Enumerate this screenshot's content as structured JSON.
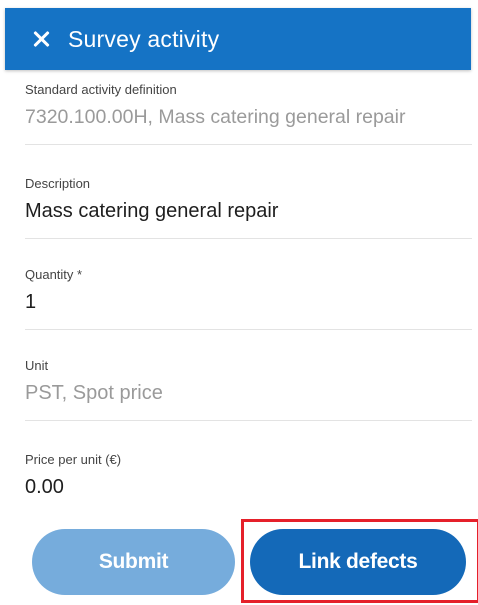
{
  "header": {
    "title": "Survey activity",
    "close_icon": "close-icon",
    "background_color": "#1573c5"
  },
  "fields": {
    "standard_activity": {
      "label": "Standard activity definition",
      "value": "7320.100.00H, Mass catering general repair"
    },
    "description": {
      "label": "Description",
      "value": "Mass catering general repair"
    },
    "quantity": {
      "label": "Quantity *",
      "value": "1"
    },
    "unit": {
      "label": "Unit",
      "value": "PST, Spot price"
    },
    "price_per_unit": {
      "label": "Price per unit (€)",
      "value": "0.00"
    }
  },
  "actions": {
    "submit_label": "Submit",
    "link_defects_label": "Link defects",
    "submit_color": "#76acdc",
    "link_defects_color": "#1469b8",
    "highlight_color": "#e5202a"
  }
}
